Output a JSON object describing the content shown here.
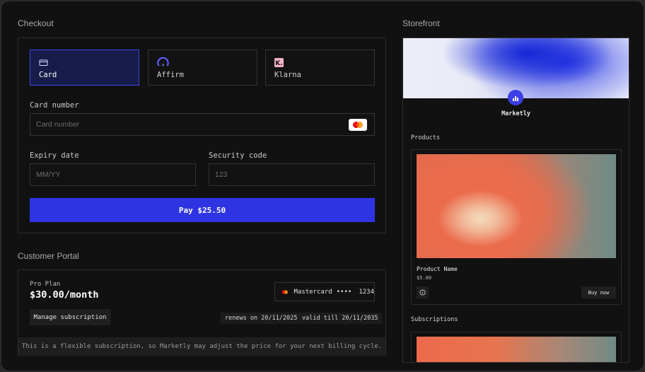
{
  "checkout": {
    "title": "Checkout",
    "payment_methods": [
      {
        "label": "Card",
        "icon": "credit-card-icon",
        "active": true
      },
      {
        "label": "Affirm",
        "icon": "affirm-logo-icon",
        "active": false
      },
      {
        "label": "Klarna",
        "icon": "klarna-logo-icon",
        "active": false
      }
    ],
    "card_number": {
      "label": "Card number",
      "placeholder": "Card number",
      "brand_icon": "mastercard-icon"
    },
    "expiry": {
      "label": "Expiry date",
      "placeholder": "MM/YY"
    },
    "security": {
      "label": "Security code",
      "placeholder": "123"
    },
    "pay_button": "Pay $25.50"
  },
  "portal": {
    "title": "Customer Portal",
    "plan_name": "Pro Plan",
    "plan_price": "$30.00/month",
    "payment_method": {
      "brand": "Mastercard",
      "masked": "••••",
      "last4": "1234"
    },
    "manage_button": "Manage subscription",
    "renews": "renews on 20/11/2025",
    "valid": "valid till 20/11/2035",
    "notice": "This is a flexible subscription, so Marketly may adjust the price for your next billing cycle."
  },
  "storefront": {
    "title": "Storefront",
    "store_name": "Marketly",
    "products_heading": "Products",
    "product": {
      "name": "Product Name",
      "price": "$5.00",
      "buy_label": "Buy now"
    },
    "subscriptions_heading": "Subscriptions"
  },
  "colors": {
    "accent": "#2f34e3",
    "active_tab_bg": "#181c4a",
    "background": "#111111"
  }
}
